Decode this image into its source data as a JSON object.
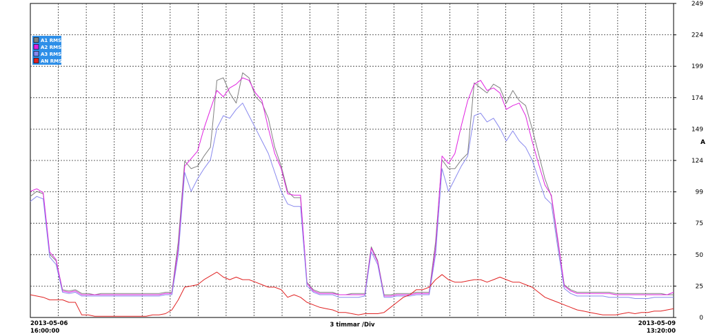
{
  "chart_data": {
    "type": "line",
    "title": "",
    "ylabel": "A",
    "xlabel": "3 timmar /Div",
    "x_start_label": [
      "2013-05-06",
      "16:00:00"
    ],
    "x_end_label": [
      "2013-05-09",
      "13:20:00"
    ],
    "yticks": [
      0,
      25,
      50,
      75,
      99,
      124,
      149,
      174,
      199,
      224,
      249
    ],
    "ylim": [
      0,
      249
    ],
    "grid": true,
    "grid_vertical_divisions": 23,
    "legend_position": "top-left",
    "legend_bg": "#2e8fe8",
    "series": [
      {
        "name": "A1 RMS",
        "color": "#808080",
        "values": [
          96,
          100,
          98,
          50,
          45,
          22,
          21,
          22,
          19,
          19,
          18,
          19,
          19,
          19,
          19,
          19,
          19,
          19,
          19,
          19,
          19,
          20,
          20,
          60,
          124,
          118,
          120,
          128,
          135,
          188,
          190,
          178,
          170,
          194,
          190,
          175,
          170,
          158,
          135,
          120,
          100,
          95,
          95,
          28,
          22,
          20,
          20,
          20,
          18,
          18,
          19,
          19,
          19,
          56,
          45,
          18,
          18,
          19,
          19,
          19,
          20,
          20,
          20,
          60,
          125,
          118,
          118,
          125,
          130,
          186,
          182,
          178,
          185,
          182,
          170,
          180,
          172,
          168,
          150,
          130,
          110,
          96,
          60,
          26,
          22,
          20,
          20,
          20,
          20,
          20,
          20,
          19,
          19,
          19,
          19,
          19,
          19,
          19,
          19,
          18,
          18
        ]
      },
      {
        "name": "A2 RMS",
        "color": "#e020e0",
        "values": [
          100,
          102,
          99,
          52,
          46,
          21,
          20,
          21,
          18,
          18,
          18,
          18,
          18,
          18,
          18,
          18,
          18,
          18,
          18,
          18,
          18,
          19,
          19,
          55,
          120,
          126,
          132,
          150,
          165,
          180,
          175,
          182,
          185,
          190,
          188,
          178,
          172,
          150,
          130,
          118,
          98,
          97,
          97,
          27,
          21,
          19,
          19,
          19,
          18,
          18,
          18,
          18,
          18,
          55,
          44,
          17,
          17,
          18,
          18,
          18,
          19,
          19,
          19,
          55,
          128,
          122,
          130,
          152,
          172,
          185,
          188,
          180,
          182,
          178,
          165,
          168,
          170,
          160,
          140,
          122,
          105,
          97,
          62,
          25,
          21,
          19,
          19,
          19,
          19,
          19,
          19,
          18,
          18,
          18,
          18,
          18,
          18,
          18,
          18,
          18,
          20
        ]
      },
      {
        "name": "A3 RMS",
        "color": "#8888ee",
        "values": [
          92,
          96,
          94,
          48,
          42,
          20,
          19,
          20,
          17,
          17,
          17,
          17,
          17,
          17,
          17,
          17,
          17,
          17,
          17,
          17,
          17,
          18,
          18,
          50,
          115,
          100,
          110,
          118,
          125,
          150,
          160,
          158,
          165,
          170,
          160,
          150,
          140,
          130,
          115,
          100,
          90,
          88,
          88,
          25,
          20,
          18,
          18,
          18,
          16,
          16,
          16,
          16,
          17,
          52,
          42,
          16,
          16,
          17,
          17,
          17,
          18,
          18,
          18,
          50,
          118,
          100,
          110,
          120,
          128,
          160,
          162,
          155,
          158,
          150,
          140,
          148,
          140,
          135,
          125,
          110,
          95,
          90,
          55,
          23,
          19,
          17,
          17,
          17,
          17,
          17,
          16,
          16,
          16,
          16,
          15,
          15,
          15,
          16,
          16,
          16,
          16
        ]
      },
      {
        "name": "AN RMS",
        "color": "#e02020",
        "values": [
          18,
          17,
          16,
          14,
          14,
          14,
          12,
          12,
          2,
          2,
          1,
          1,
          1,
          1,
          1,
          1,
          1,
          1,
          1,
          2,
          2,
          3,
          6,
          14,
          24,
          25,
          26,
          30,
          33,
          36,
          32,
          30,
          32,
          30,
          30,
          28,
          26,
          24,
          24,
          22,
          16,
          18,
          16,
          12,
          10,
          8,
          7,
          6,
          4,
          4,
          3,
          2,
          3,
          3,
          3,
          4,
          8,
          12,
          16,
          18,
          22,
          22,
          24,
          30,
          34,
          30,
          28,
          28,
          29,
          30,
          30,
          28,
          30,
          32,
          30,
          28,
          28,
          26,
          24,
          20,
          16,
          14,
          12,
          10,
          8,
          6,
          5,
          4,
          3,
          2,
          2,
          2,
          3,
          4,
          3,
          4,
          4,
          5,
          5,
          6,
          7
        ]
      }
    ]
  }
}
